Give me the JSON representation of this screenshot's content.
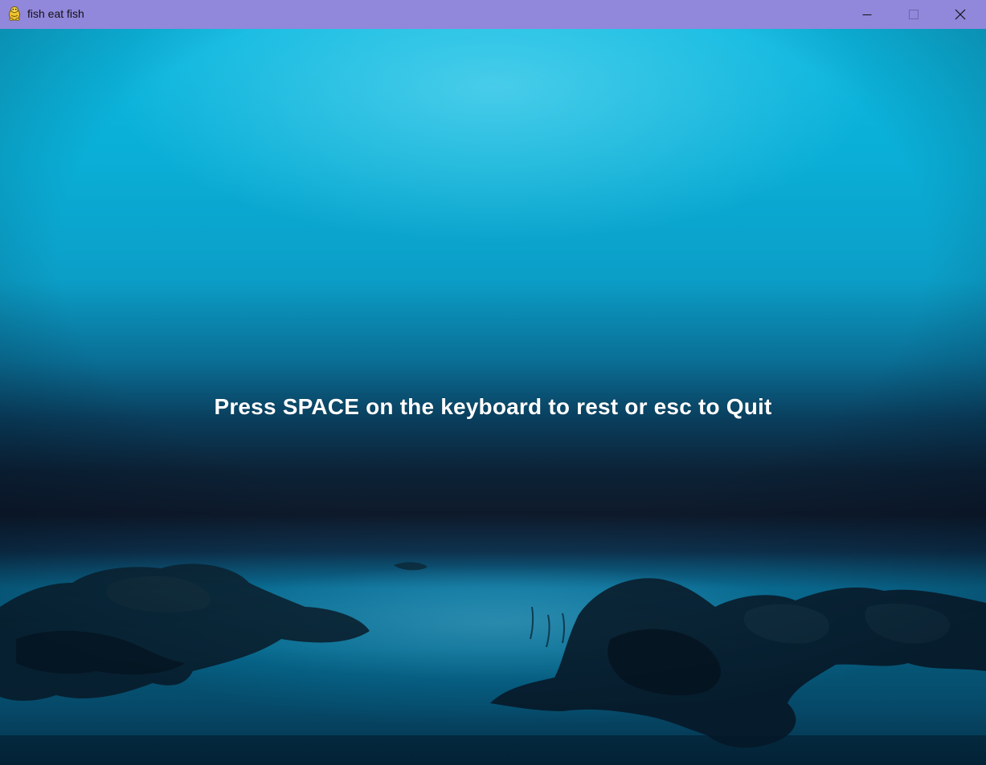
{
  "window": {
    "title": "fish eat fish",
    "icon": "pygame-snake-icon",
    "controls": [
      "minimize-icon",
      "maximize-icon",
      "close-icon"
    ]
  },
  "game": {
    "message": "Press SPACE on the keyboard to rest or esc to Quit",
    "background": "underwater-scene"
  },
  "colors": {
    "titlebar": "#9187db",
    "text": "#ffffff",
    "water_top": "#0db8e0",
    "water_dark": "#0e1a2b"
  }
}
